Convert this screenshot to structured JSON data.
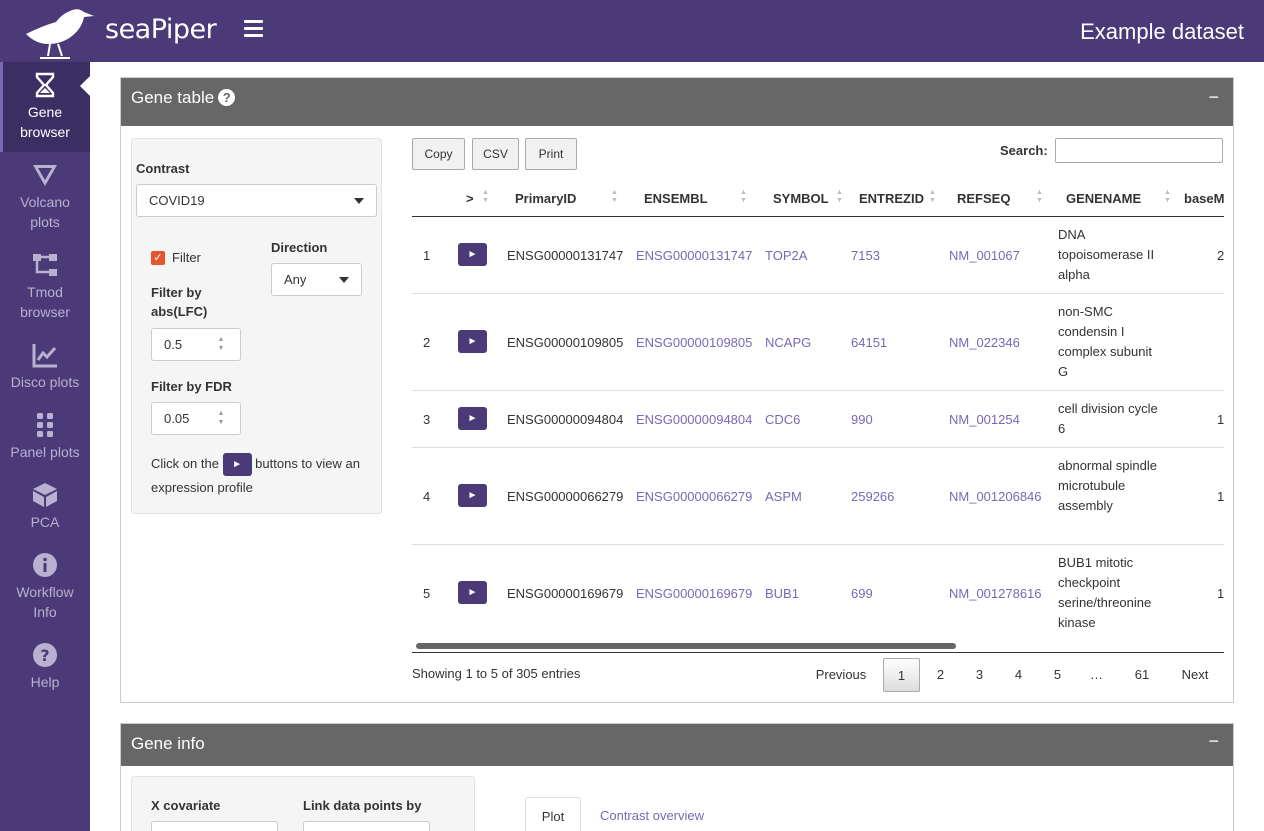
{
  "app": {
    "logo_text": "seaPiper",
    "dataset_title": "Example dataset"
  },
  "sidebar": {
    "items": [
      {
        "label": "Gene browser",
        "line1": "Gene",
        "line2": "browser"
      },
      {
        "label": "Volcano plots",
        "line1": "Volcano",
        "line2": "plots"
      },
      {
        "label": "Tmod browser",
        "line1": "Tmod",
        "line2": "browser"
      },
      {
        "label": "Disco plots",
        "line1": "Disco plots",
        "line2": ""
      },
      {
        "label": "Panel plots",
        "line1": "Panel plots",
        "line2": ""
      },
      {
        "label": "PCA",
        "line1": "PCA",
        "line2": ""
      },
      {
        "label": "Workflow Info",
        "line1": "Workflow",
        "line2": "Info"
      },
      {
        "label": "Help",
        "line1": "Help",
        "line2": ""
      }
    ]
  },
  "gene_table": {
    "title": "Gene table",
    "collapse": "−",
    "help": "?",
    "filters": {
      "contrast_label": "Contrast",
      "contrast_value": "COVID19",
      "filter_label": "Filter",
      "filter_checked": true,
      "direction_label": "Direction",
      "direction_value": "Any",
      "lfc_label_1": "Filter by",
      "lfc_label_2": "abs(LFC)",
      "lfc_value": "0.5",
      "fdr_label": "Filter by FDR",
      "fdr_value": "0.05",
      "help_text_before": "Click on the",
      "help_text_after": "buttons to view an expression profile",
      "play_glyph": "►"
    },
    "buttons": {
      "copy": "Copy",
      "csv": "CSV",
      "print": "Print"
    },
    "search_label": "Search:",
    "search_value": "",
    "columns": [
      "",
      ">",
      "PrimaryID",
      "ENSEMBL",
      "SYMBOL",
      "ENTREZID",
      "REFSEQ",
      "GENENAME",
      "baseM"
    ],
    "rows": [
      {
        "n": "1",
        "primary": "ENSG00000131747",
        "ensembl": "ENSG00000131747",
        "symbol": "TOP2A",
        "entrez": "7153",
        "refseq": "NM_001067",
        "genename": "DNA topoisomerase II alpha",
        "basem": "2"
      },
      {
        "n": "2",
        "primary": "ENSG00000109805",
        "ensembl": "ENSG00000109805",
        "symbol": "NCAPG",
        "entrez": "64151",
        "refseq": "NM_022346",
        "genename": "non-SMC condensin I complex subunit G",
        "basem": ""
      },
      {
        "n": "3",
        "primary": "ENSG00000094804",
        "ensembl": "ENSG00000094804",
        "symbol": "CDC6",
        "entrez": "990",
        "refseq": "NM_001254",
        "genename": "cell division cycle 6",
        "basem": "1"
      },
      {
        "n": "4",
        "primary": "ENSG00000066279",
        "ensembl": "ENSG00000066279",
        "symbol": "ASPM",
        "entrez": "259266",
        "refseq": "NM_001206846",
        "genename": "abnormal spindle microtubule assembly",
        "basem": "1"
      },
      {
        "n": "5",
        "primary": "ENSG00000169679",
        "ensembl": "ENSG00000169679",
        "symbol": "BUB1",
        "entrez": "699",
        "refseq": "NM_001278616",
        "genename": "BUB1 mitotic checkpoint serine/threonine kinase",
        "basem": "1"
      }
    ],
    "info": "Showing 1 to 5 of 305 entries",
    "pagination": {
      "previous": "Previous",
      "pages": [
        "1",
        "2",
        "3",
        "4",
        "5",
        "…",
        "61"
      ],
      "current": "1",
      "next": "Next"
    }
  },
  "gene_info": {
    "title": "Gene info",
    "collapse": "−",
    "x_covariate_label": "X covariate",
    "link_label": "Link data points by",
    "tabs": [
      "Plot",
      "Contrast overview"
    ],
    "active_tab": "Plot"
  }
}
